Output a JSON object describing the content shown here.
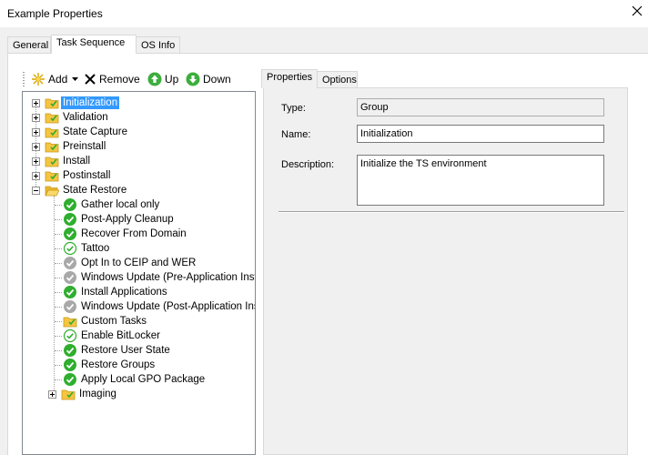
{
  "window": {
    "title": "Example Properties"
  },
  "tabs": [
    "General",
    "Task Sequence",
    "OS Info"
  ],
  "toolbar": {
    "add": "Add",
    "remove": "Remove",
    "up": "Up",
    "down": "Down"
  },
  "tree": {
    "groups": [
      "Initialization",
      "Validation",
      "State Capture",
      "Preinstall",
      "Install",
      "Postinstall",
      "State Restore"
    ],
    "children": [
      {
        "label": "Gather local only",
        "icon": "green-check-icon"
      },
      {
        "label": "Post-Apply Cleanup",
        "icon": "green-check-icon"
      },
      {
        "label": "Recover From Domain",
        "icon": "green-check-icon"
      },
      {
        "label": "Tattoo",
        "icon": "check-outline-icon"
      },
      {
        "label": "Opt In to CEIP and WER",
        "icon": "grey-check-icon"
      },
      {
        "label": "Windows Update (Pre-Application Installa",
        "icon": "grey-check-icon"
      },
      {
        "label": "Install Applications",
        "icon": "green-check-icon"
      },
      {
        "label": "Windows Update (Post-Application Install",
        "icon": "grey-check-icon"
      },
      {
        "label": "Custom Tasks",
        "icon": "folder-icon"
      },
      {
        "label": "Enable BitLocker",
        "icon": "check-outline-icon"
      },
      {
        "label": "Restore User State",
        "icon": "green-check-icon"
      },
      {
        "label": "Restore Groups",
        "icon": "green-check-icon"
      },
      {
        "label": "Apply Local GPO Package",
        "icon": "green-check-icon"
      }
    ],
    "imaging": "Imaging"
  },
  "subtabs": [
    "Properties",
    "Options"
  ],
  "properties": {
    "type_label": "Type:",
    "type_value": "Group",
    "name_label": "Name:",
    "name_value": "Initialization",
    "description_label": "Description:",
    "description_value": "Initialize the TS environment"
  },
  "colors": {
    "selection": "#3399ff",
    "folder": "#f5c542",
    "green": "#2fae2f"
  }
}
